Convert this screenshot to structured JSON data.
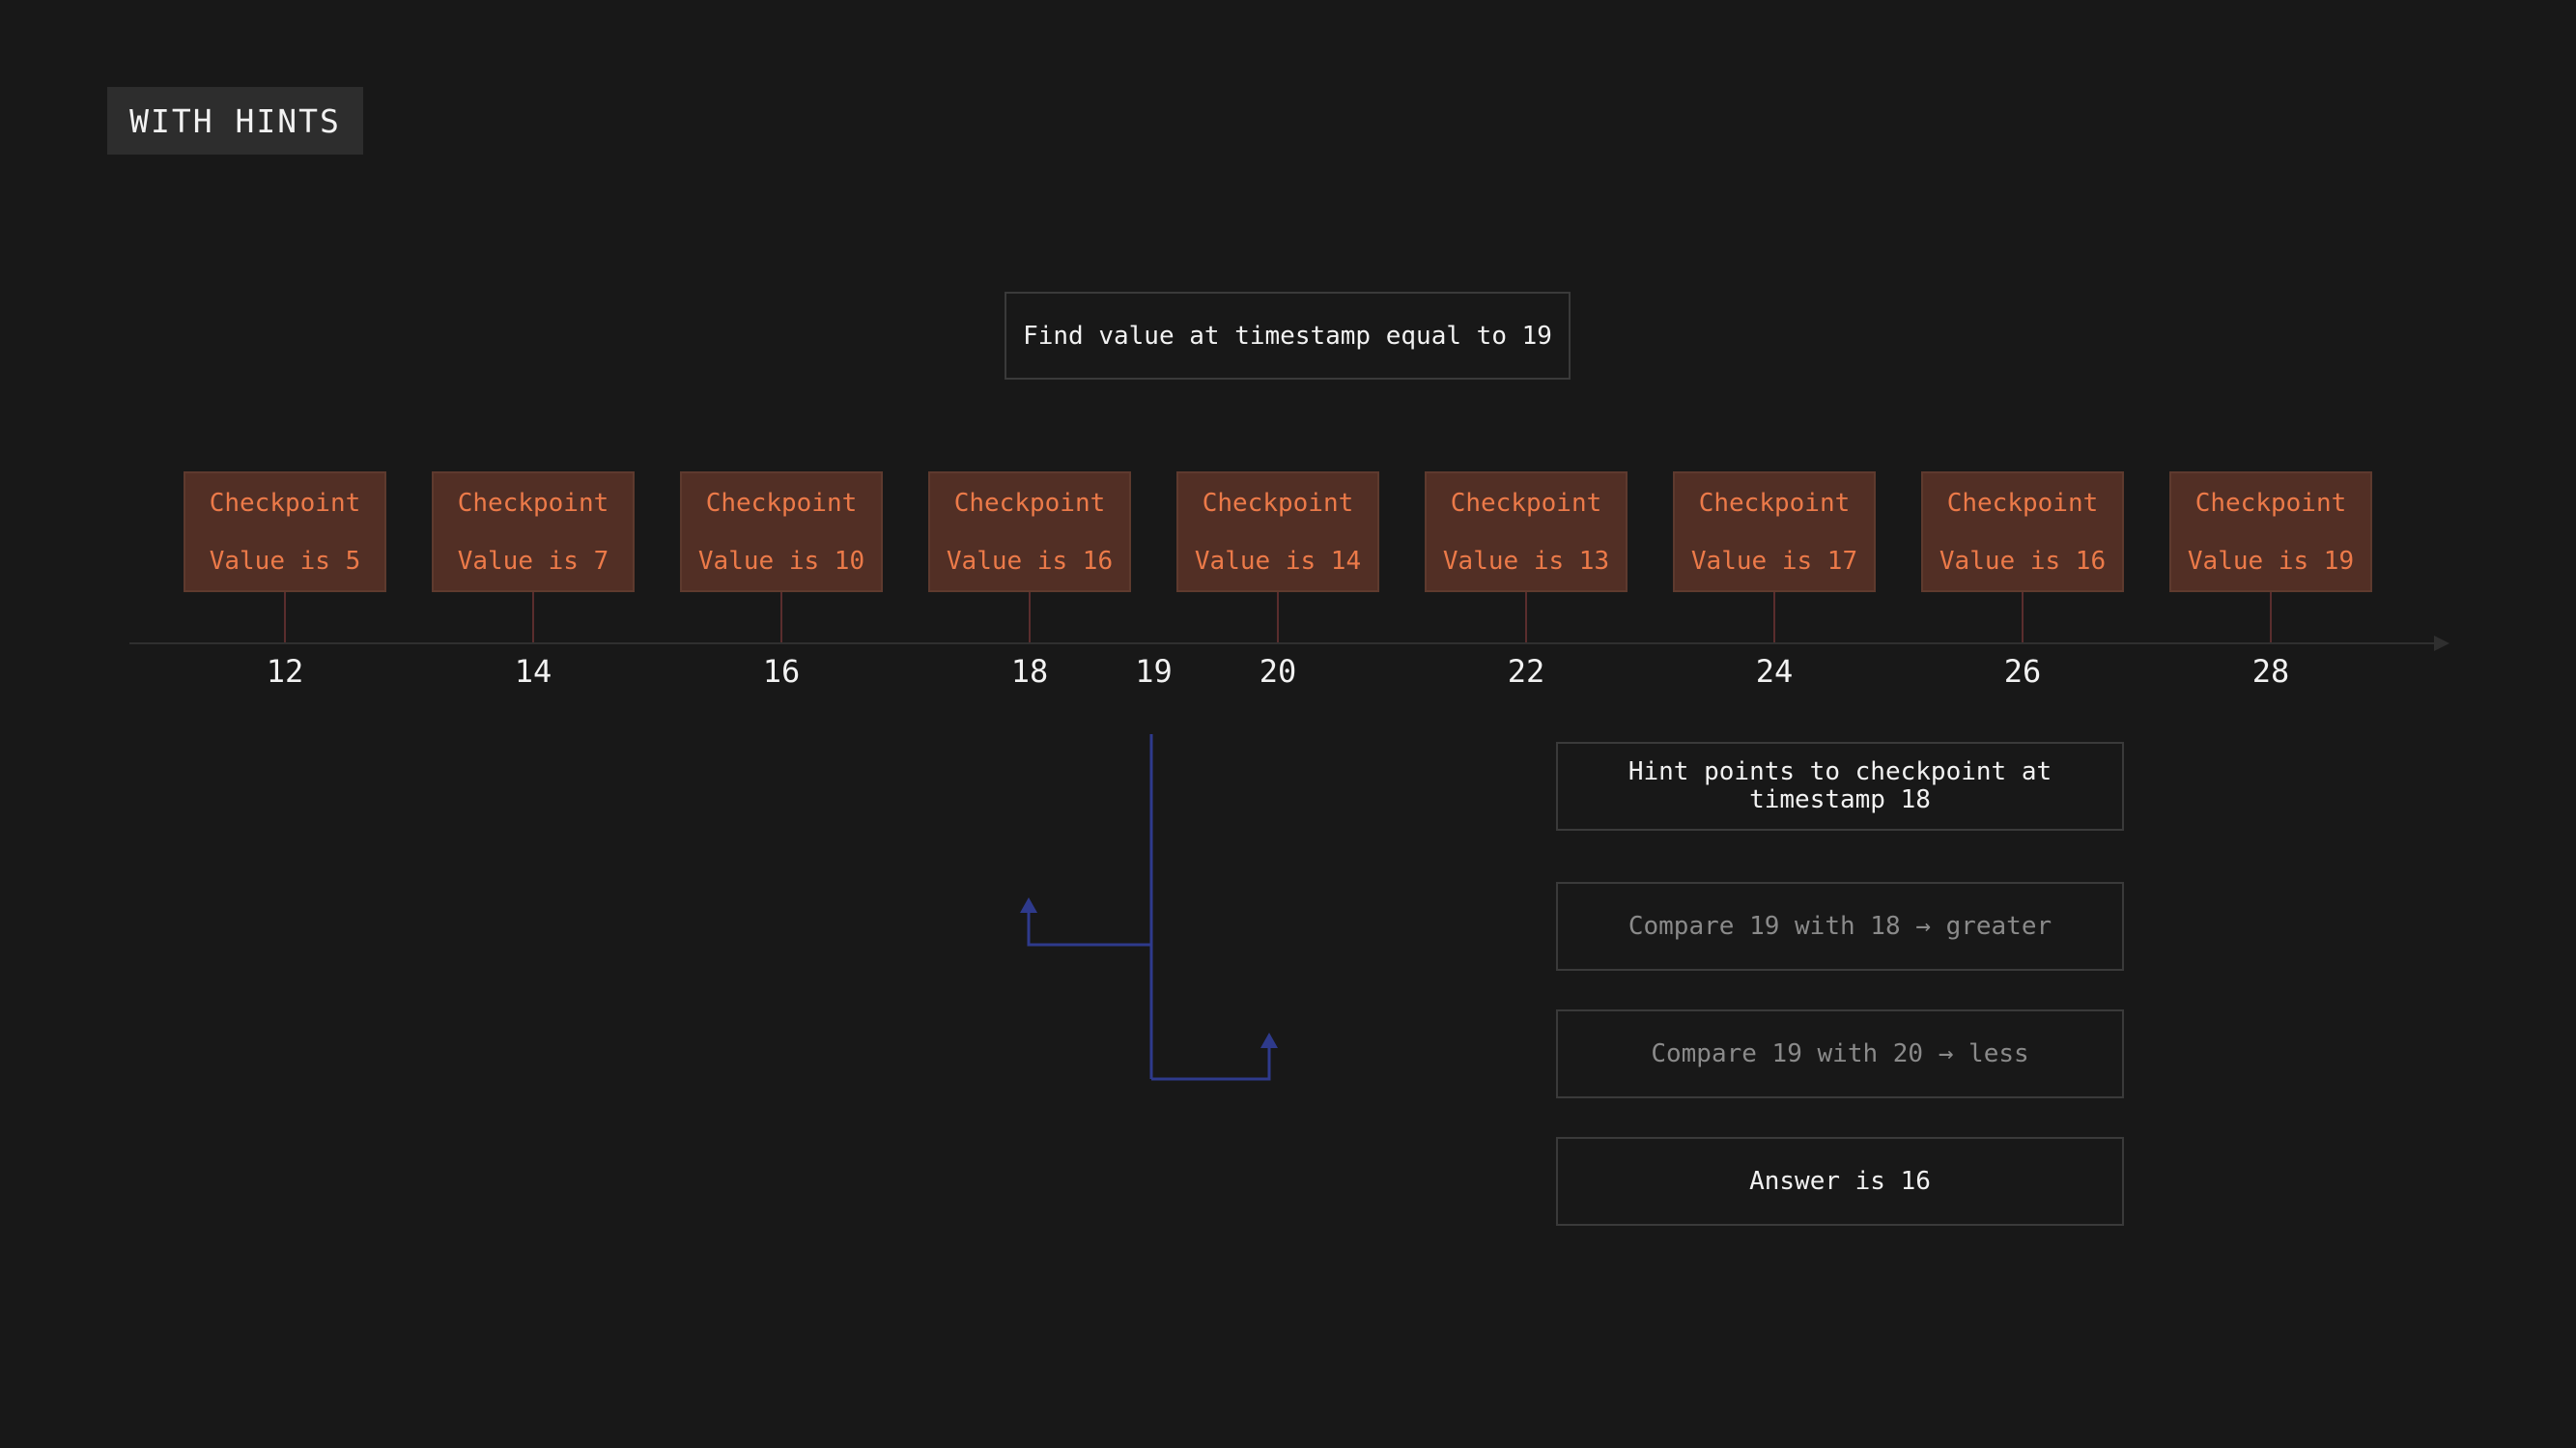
{
  "tag": "WITH HINTS",
  "query": "Find value at timestamp equal to 19",
  "checkpoints": [
    {
      "title": "Checkpoint",
      "value": "Value is 5",
      "timestamp": 12
    },
    {
      "title": "Checkpoint",
      "value": "Value is 7",
      "timestamp": 14
    },
    {
      "title": "Checkpoint",
      "value": "Value is 10",
      "timestamp": 16
    },
    {
      "title": "Checkpoint",
      "value": "Value is 16",
      "timestamp": 18
    },
    {
      "title": "Checkpoint",
      "value": "Value is 14",
      "timestamp": 20
    },
    {
      "title": "Checkpoint",
      "value": "Value is 13",
      "timestamp": 22
    },
    {
      "title": "Checkpoint",
      "value": "Value is 17",
      "timestamp": 24
    },
    {
      "title": "Checkpoint",
      "value": "Value is 16",
      "timestamp": 26
    },
    {
      "title": "Checkpoint",
      "value": "Value is 19",
      "timestamp": 28
    }
  ],
  "ticks": [
    "12",
    "14",
    "16",
    "18",
    "19",
    "20",
    "22",
    "24",
    "26",
    "28"
  ],
  "query_timestamp": 19,
  "steps": [
    {
      "text": "Hint points to checkpoint at timestamp 18",
      "style": "bright"
    },
    {
      "text": "Compare 19 with 18 → greater",
      "style": "dim"
    },
    {
      "text": "Compare 19 with 20 → less",
      "style": "dim"
    },
    {
      "text": "Answer is 16",
      "style": "bright"
    }
  ],
  "colors": {
    "checkpoint_fill": "#522f25",
    "checkpoint_text": "#ec7a49",
    "connector": "#5a2d2d",
    "arrow": "#2e3a8c",
    "axis": "#2f2f2f"
  }
}
